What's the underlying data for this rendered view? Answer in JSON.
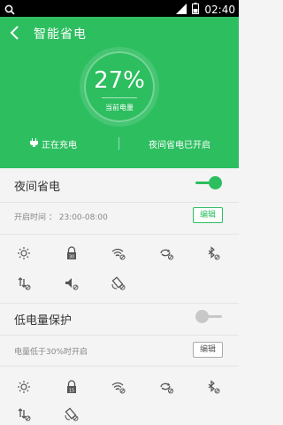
{
  "status_bar": {
    "time": "02:40"
  },
  "header": {
    "title": "智能省电",
    "battery_percent": "27%",
    "battery_label": "当前电量",
    "charging_text": "正在充电",
    "night_mode_status": "夜间省电已开启"
  },
  "night_saving": {
    "title": "夜间省电",
    "enabled": true,
    "time_label": "开启时间 ： 23:00-08:00",
    "edit_label": "编辑",
    "icons": [
      "brightness-icon",
      "screen-timeout-icon",
      "wifi-off-icon",
      "sync-off-icon",
      "bluetooth-off-icon",
      "mobile-data-off-icon",
      "sound-off-icon",
      "auto-rotate-off-icon"
    ],
    "timeout_value": "30"
  },
  "low_battery": {
    "title": "低电量保护",
    "enabled": false,
    "threshold_label": "电量低于30%时开启",
    "edit_label": "编辑",
    "icons": [
      "brightness-icon",
      "screen-timeout-icon",
      "wifi-off-icon",
      "sync-off-icon",
      "bluetooth-off-icon",
      "mobile-data-off-icon",
      "auto-rotate-off-icon"
    ],
    "timeout_value": "15"
  },
  "colors": {
    "accent": "#2dbe60",
    "toggle_off": "#c8c8c8"
  }
}
